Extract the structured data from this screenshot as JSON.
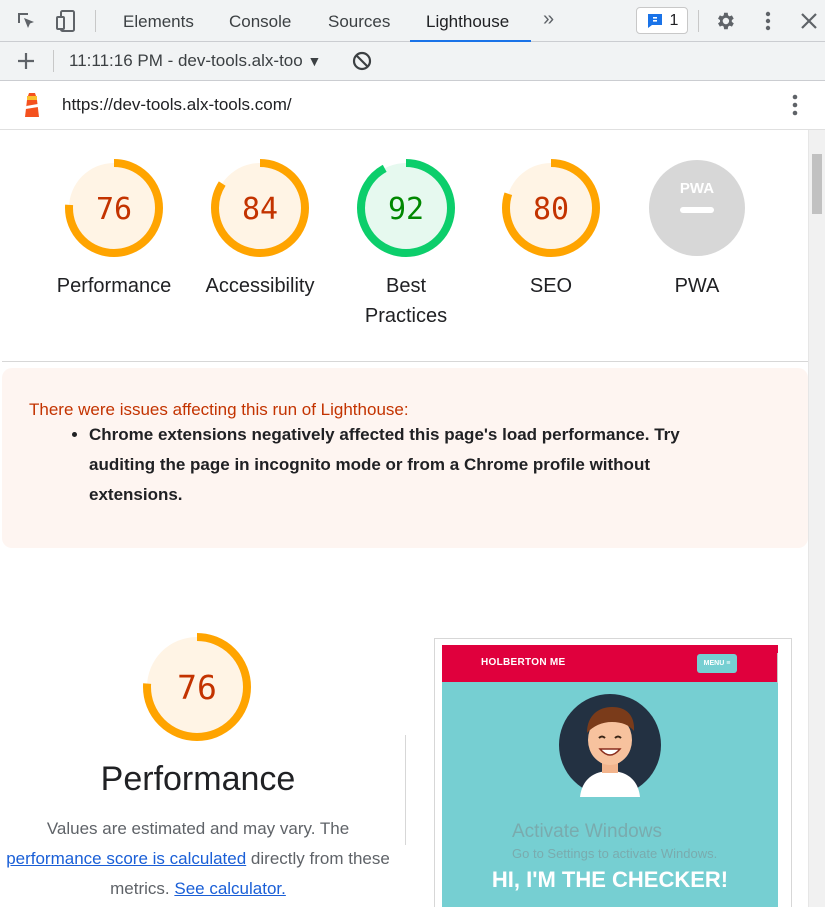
{
  "devtools": {
    "tabs": [
      {
        "label": "Elements"
      },
      {
        "label": "Console"
      },
      {
        "label": "Sources"
      },
      {
        "label": "Lighthouse"
      }
    ],
    "issues_count": "1",
    "more_tabs_glyph": "»"
  },
  "toolbar": {
    "report_label": "11:11:16 PM - dev-tools.alx-too",
    "dropdown_glyph": "▼"
  },
  "urlbar": {
    "url": "https://dev-tools.alx-tools.com/"
  },
  "gauges": [
    {
      "score": "76",
      "label": "Performance",
      "value": 76,
      "color": "#ffa400",
      "bg": "#fff4e5",
      "text_color": "#c33300"
    },
    {
      "score": "84",
      "label": "Accessibility",
      "value": 84,
      "color": "#ffa400",
      "bg": "#fff4e5",
      "text_color": "#c33300"
    },
    {
      "score": "92",
      "label": "Best Practices",
      "value": 92,
      "color": "#0cce6b",
      "bg": "#e6f9ef",
      "text_color": "#008800"
    },
    {
      "score": "80",
      "label": "SEO",
      "value": 80,
      "color": "#ffa400",
      "bg": "#fff4e5",
      "text_color": "#c33300"
    },
    {
      "score": "",
      "label": "PWA",
      "badge_text": "PWA",
      "color": "#d7d7d7"
    }
  ],
  "warning": {
    "heading": "There were issues affecting this run of Lighthouse:",
    "items": [
      "Chrome extensions negatively affected this page's load performance. Try auditing the page in incognito mode or from a Chrome profile without extensions."
    ]
  },
  "performance": {
    "score": "76",
    "value": 76,
    "title": "Performance",
    "desc_line1": "Values are estimated and may vary. The",
    "link1": "performance score is calculated",
    "desc_line2": " directly from these",
    "desc_line3": "metrics. ",
    "link2": "See calculator."
  },
  "screenshot": {
    "brand": "HOLBERTON ME",
    "menu": "MENU ≡",
    "heading": "HI, I'M THE CHECKER!"
  },
  "watermark": {
    "line1": "Activate Windows",
    "line2": "Go to Settings to activate Windows."
  }
}
